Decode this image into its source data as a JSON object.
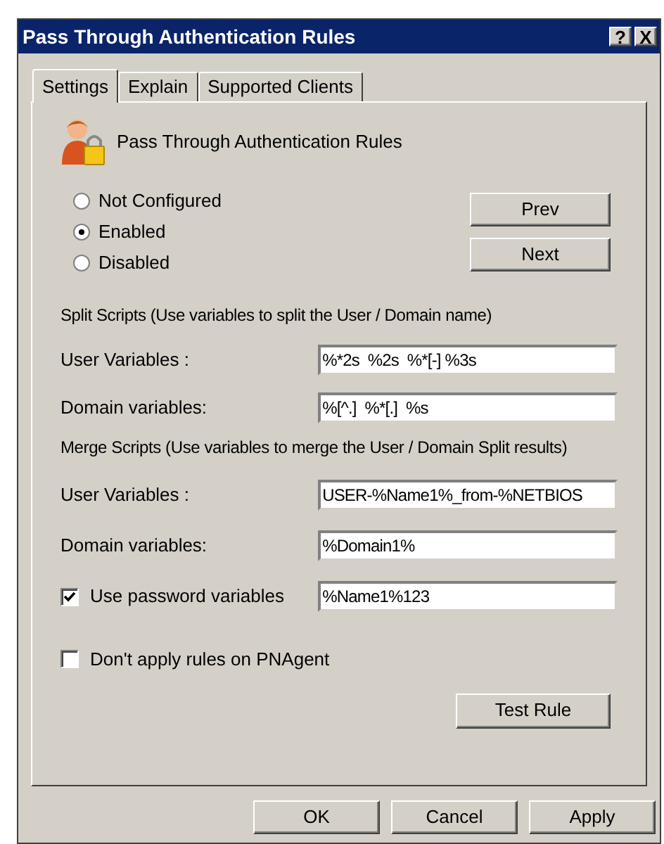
{
  "window": {
    "title": "Pass Through Authentication Rules",
    "help_button": "?",
    "close_button": "X"
  },
  "tabs": [
    {
      "label": "Settings",
      "selected": true
    },
    {
      "label": "Explain",
      "selected": false
    },
    {
      "label": "Supported Clients",
      "selected": false
    }
  ],
  "header": "Pass Through Authentication Rules",
  "options": [
    {
      "label": "Not Configured",
      "selected": false
    },
    {
      "label": "Enabled",
      "selected": true
    },
    {
      "label": "Disabled",
      "selected": false
    }
  ],
  "nav_buttons": [
    "Prev",
    "Next"
  ],
  "split": {
    "heading": "Split Scripts (Use variables to split the User / Domain name)",
    "fields": [
      {
        "label": "User Variables :",
        "value": "%*2s  %2s  %*[-] %3s"
      },
      {
        "label": "Domain variables:",
        "value": "%[^.]  %*[.]  %s"
      }
    ]
  },
  "merge": {
    "heading": "Merge Scripts (Use variables to merge the User / Domain Split results)",
    "fields": [
      {
        "kind": "label",
        "label": "User Variables :",
        "value": "USER-%Name1%_from-%NETBIOS"
      },
      {
        "kind": "label",
        "label": "Domain variables:",
        "value": "%Domain1%"
      },
      {
        "kind": "checkbox",
        "label": "Use password variables",
        "checked": true,
        "value": "%Name1%123"
      }
    ]
  },
  "pnagent": {
    "label": "Don't apply rules on PNAgent",
    "checked": false
  },
  "test_button": "Test Rule",
  "buttons": [
    "OK",
    "Cancel",
    "Apply"
  ]
}
